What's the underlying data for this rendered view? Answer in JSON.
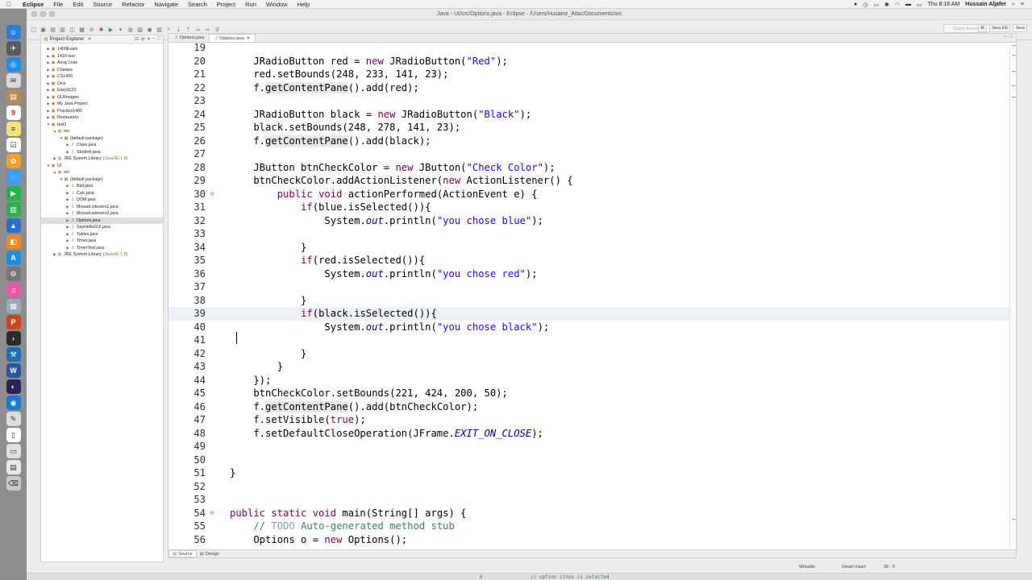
{
  "menubar": {
    "app": "Eclipse",
    "items": [
      "File",
      "Edit",
      "Source",
      "Refactor",
      "Navigate",
      "Search",
      "Project",
      "Run",
      "Window",
      "Help"
    ],
    "clock": "Thu 8:16 AM",
    "user": "Hussain Aljafer"
  },
  "window": {
    "title": "Java - UI/src/Options.java - Eclipse - /Users/Husainz_iMac/Documents/ws",
    "quick_access_placeholder": "Quick Access",
    "perspectives": [
      "Java EE",
      "Java"
    ]
  },
  "explorer": {
    "title": "Project Explorer",
    "tree": [
      {
        "label": "1400Exam",
        "depth": 0,
        "kind": "project",
        "expanded": false
      },
      {
        "label": "1410 test",
        "depth": 0,
        "kind": "project",
        "expanded": false
      },
      {
        "label": "Array Lists",
        "depth": 0,
        "kind": "project",
        "expanded": false
      },
      {
        "label": "Classes",
        "depth": 0,
        "kind": "project",
        "expanded": false
      },
      {
        "label": "CS1400",
        "depth": 0,
        "kind": "project",
        "expanded": false
      },
      {
        "label": "Dice",
        "depth": 0,
        "kind": "project",
        "expanded": false
      },
      {
        "label": "EasySCN",
        "depth": 0,
        "kind": "project",
        "expanded": false
      },
      {
        "label": "GUIImages",
        "depth": 0,
        "kind": "project",
        "expanded": false
      },
      {
        "label": "My Java Project",
        "depth": 0,
        "kind": "project",
        "expanded": false
      },
      {
        "label": "Practice1400",
        "depth": 0,
        "kind": "project",
        "expanded": false
      },
      {
        "label": "Restaurant",
        "depth": 0,
        "kind": "project",
        "expanded": false
      },
      {
        "label": "test2",
        "depth": 0,
        "kind": "project",
        "expanded": true
      },
      {
        "label": "src",
        "depth": 1,
        "kind": "folder",
        "expanded": true
      },
      {
        "label": "(default package)",
        "depth": 2,
        "kind": "package",
        "expanded": true
      },
      {
        "label": "Class.java",
        "depth": 3,
        "kind": "java",
        "expanded": false
      },
      {
        "label": "Student.java",
        "depth": 3,
        "kind": "java",
        "expanded": false
      },
      {
        "label": "JRE System Library",
        "suffix": "[JavaSE-1.8]",
        "depth": 1,
        "kind": "library",
        "expanded": false
      },
      {
        "label": "UI",
        "depth": 0,
        "kind": "project",
        "expanded": true
      },
      {
        "label": "src",
        "depth": 1,
        "kind": "folder",
        "expanded": true
      },
      {
        "label": "(default package)",
        "depth": 2,
        "kind": "package",
        "expanded": true
      },
      {
        "label": "Ball.java",
        "depth": 3,
        "kind": "java",
        "expanded": false
      },
      {
        "label": "Calc.java",
        "depth": 3,
        "kind": "java",
        "expanded": false
      },
      {
        "label": "DOM.java",
        "depth": 3,
        "kind": "java",
        "expanded": false
      },
      {
        "label": "MouseListeners1.java",
        "depth": 3,
        "kind": "java",
        "expanded": false
      },
      {
        "label": "MouseListeners2.java",
        "depth": 3,
        "kind": "java",
        "expanded": false
      },
      {
        "label": "Options.java",
        "depth": 3,
        "kind": "java",
        "expanded": false,
        "selected": true
      },
      {
        "label": "SayHelloGUI.java",
        "depth": 3,
        "kind": "java",
        "expanded": false
      },
      {
        "label": "Tables.java",
        "depth": 3,
        "kind": "java",
        "expanded": false
      },
      {
        "label": "Timer.java",
        "depth": 3,
        "kind": "java",
        "expanded": false
      },
      {
        "label": "TimerTest.java",
        "depth": 3,
        "kind": "java",
        "expanded": false
      },
      {
        "label": "JRE System Library",
        "suffix": "[JavaSE-1.8]",
        "depth": 1,
        "kind": "library",
        "expanded": false
      }
    ]
  },
  "editor": {
    "tabs": [
      {
        "label": "Options.java",
        "active": false
      },
      {
        "label": "Options.java",
        "active": true
      }
    ],
    "current_line": 39,
    "lines": [
      {
        "n": 19,
        "fold": "",
        "toks": []
      },
      {
        "n": 20,
        "fold": "",
        "toks": [
          [
            "",
            "    JRadioButton red = "
          ],
          [
            "kw",
            "new"
          ],
          [
            "",
            " JRadioButton("
          ],
          [
            "str",
            "\"Red\""
          ],
          [
            "",
            ");"
          ]
        ]
      },
      {
        "n": 21,
        "fold": "",
        "toks": [
          [
            "",
            "    red.setBounds(248, 233, 141, 23);"
          ]
        ]
      },
      {
        "n": 22,
        "fold": "",
        "toks": [
          [
            "",
            "    f."
          ],
          [
            "hl",
            "getContentPane"
          ],
          [
            "",
            "().add(red);"
          ]
        ]
      },
      {
        "n": 23,
        "fold": "",
        "toks": []
      },
      {
        "n": 24,
        "fold": "",
        "toks": [
          [
            "",
            "    JRadioButton black = "
          ],
          [
            "kw",
            "new"
          ],
          [
            "",
            " JRadioButton("
          ],
          [
            "str",
            "\"Black\""
          ],
          [
            "",
            ");"
          ]
        ]
      },
      {
        "n": 25,
        "fold": "",
        "toks": [
          [
            "",
            "    black.setBounds(248, 278, 141, 23);"
          ]
        ]
      },
      {
        "n": 26,
        "fold": "",
        "toks": [
          [
            "",
            "    f."
          ],
          [
            "hl",
            "getContentPane"
          ],
          [
            "",
            "().add(black);"
          ]
        ]
      },
      {
        "n": 27,
        "fold": "",
        "toks": []
      },
      {
        "n": 28,
        "fold": "",
        "toks": [
          [
            "",
            "    JButton btnCheckColor = "
          ],
          [
            "kw",
            "new"
          ],
          [
            "",
            " JButton("
          ],
          [
            "str",
            "\"Check Color\""
          ],
          [
            "",
            ");"
          ]
        ]
      },
      {
        "n": 29,
        "fold": "",
        "toks": [
          [
            "",
            "    btnCheckColor.addActionListener("
          ],
          [
            "kw",
            "new"
          ],
          [
            "",
            " ActionListener() {"
          ]
        ]
      },
      {
        "n": 30,
        "fold": "⊖",
        "toks": [
          [
            "",
            "        "
          ],
          [
            "kw",
            "public void"
          ],
          [
            "",
            " actionPerformed(ActionEvent e) {"
          ]
        ]
      },
      {
        "n": 31,
        "fold": "",
        "toks": [
          [
            "",
            "            "
          ],
          [
            "kw",
            "if"
          ],
          [
            "",
            "(blue.isSelected()){"
          ]
        ]
      },
      {
        "n": 32,
        "fold": "",
        "toks": [
          [
            "",
            "                System."
          ],
          [
            "field",
            "out"
          ],
          [
            "",
            ".println("
          ],
          [
            "str",
            "\"you chose blue\""
          ],
          [
            "",
            ");"
          ]
        ]
      },
      {
        "n": 33,
        "fold": "",
        "toks": []
      },
      {
        "n": 34,
        "fold": "",
        "toks": [
          [
            "",
            "            }"
          ]
        ]
      },
      {
        "n": 35,
        "fold": "",
        "toks": [
          [
            "",
            "            "
          ],
          [
            "kw",
            "if"
          ],
          [
            "",
            "(red.isSelected()){"
          ]
        ]
      },
      {
        "n": 36,
        "fold": "",
        "toks": [
          [
            "",
            "                System."
          ],
          [
            "field",
            "out"
          ],
          [
            "",
            ".println("
          ],
          [
            "str",
            "\"you chose red\""
          ],
          [
            "",
            ");"
          ]
        ]
      },
      {
        "n": 37,
        "fold": "",
        "toks": []
      },
      {
        "n": 38,
        "fold": "",
        "toks": [
          [
            "",
            "            }"
          ]
        ]
      },
      {
        "n": 39,
        "fold": "",
        "toks": [
          [
            "",
            "            "
          ],
          [
            "kw",
            "if"
          ],
          [
            "",
            "(black.isSelected()){"
          ]
        ]
      },
      {
        "n": 40,
        "fold": "",
        "toks": [
          [
            "",
            "                System."
          ],
          [
            "field",
            "out"
          ],
          [
            "",
            ".println("
          ],
          [
            "str",
            "\"you chose black\""
          ],
          [
            "",
            ");"
          ]
        ]
      },
      {
        "n": 41,
        "fold": "",
        "toks": []
      },
      {
        "n": 42,
        "fold": "",
        "toks": [
          [
            "",
            "            }"
          ]
        ]
      },
      {
        "n": 43,
        "fold": "",
        "toks": [
          [
            "",
            "        }"
          ]
        ]
      },
      {
        "n": 44,
        "fold": "",
        "toks": [
          [
            "",
            "    });"
          ]
        ]
      },
      {
        "n": 45,
        "fold": "",
        "toks": [
          [
            "",
            "    btnCheckColor.setBounds(221, 424, 200, 50);"
          ]
        ]
      },
      {
        "n": 46,
        "fold": "",
        "toks": [
          [
            "",
            "    f."
          ],
          [
            "hl",
            "getContentPane"
          ],
          [
            "",
            "().add(btnCheckColor);"
          ]
        ]
      },
      {
        "n": 47,
        "fold": "",
        "toks": [
          [
            "",
            "    f.setVisible("
          ],
          [
            "kw",
            "true"
          ],
          [
            "",
            ");"
          ]
        ]
      },
      {
        "n": 48,
        "fold": "",
        "toks": [
          [
            "",
            "    f.setDefaultCloseOperation(JFrame."
          ],
          [
            "const",
            "EXIT_ON_CLOSE"
          ],
          [
            "",
            ");"
          ]
        ]
      },
      {
        "n": 49,
        "fold": "",
        "toks": []
      },
      {
        "n": 50,
        "fold": "",
        "toks": []
      },
      {
        "n": 51,
        "fold": "",
        "toks": [
          [
            "",
            "}"
          ]
        ]
      },
      {
        "n": 52,
        "fold": "",
        "toks": []
      },
      {
        "n": 53,
        "fold": "",
        "toks": []
      },
      {
        "n": 54,
        "fold": "⊖",
        "toks": [
          [
            "kw",
            "public static void"
          ],
          [
            "",
            " main(String[] args) {"
          ]
        ]
      },
      {
        "n": 55,
        "fold": "",
        "toks": [
          [
            "comment",
            "    // "
          ],
          [
            "todo",
            "TODO"
          ],
          [
            "comment",
            " Auto-generated method stub"
          ]
        ]
      },
      {
        "n": 56,
        "fold": "",
        "toks": [
          [
            "",
            "    Options o = "
          ],
          [
            "kw",
            "new"
          ],
          [
            "",
            " Options();"
          ]
        ]
      }
    ],
    "bottom_tabs": [
      {
        "label": "Source",
        "active": true
      },
      {
        "label": "Design",
        "active": false
      }
    ]
  },
  "statusbar": {
    "writable": "Writable",
    "insert_mode": "Smart Insert",
    "position": "39 : 9"
  },
  "background_window": {
    "line_number": "8",
    "text": "// option Linux is selected"
  },
  "colors": {
    "keyword": "#7f0055",
    "string": "#2a00ff",
    "field": "#0000c0",
    "comment": "#3f7f5f",
    "current_line": "#eef2f8"
  }
}
